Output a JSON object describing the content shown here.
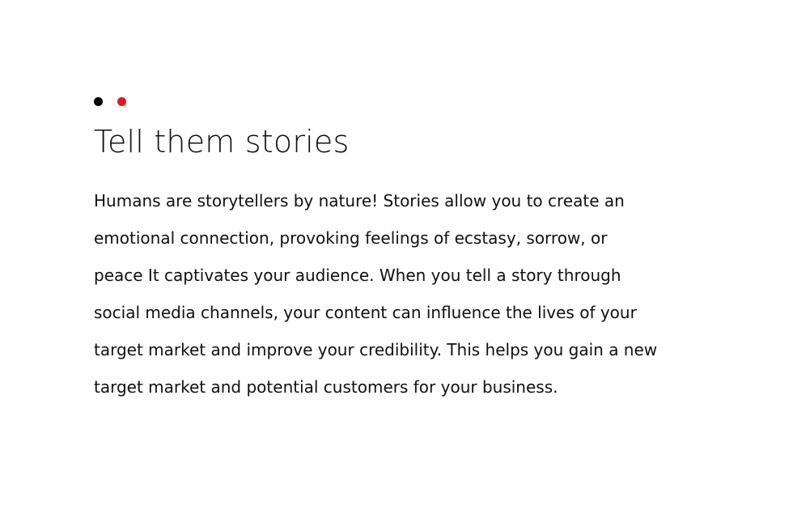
{
  "decoration": {
    "dot_colors": [
      "#000000",
      "#e0181f"
    ]
  },
  "section": {
    "title": "Tell them stories",
    "paragraph_lines": [
      "Humans are storytellers by nature! Stories allow you to create an",
      "emotional connection, provoking feelings of ecstasy, sorrow, or",
      "peace It captivates your audience. When you tell a story through",
      "social media channels, your content can influence the lives of your",
      "target market and improve your credibility. This helps you gain a new",
      "target market and potential customers for your business."
    ]
  }
}
